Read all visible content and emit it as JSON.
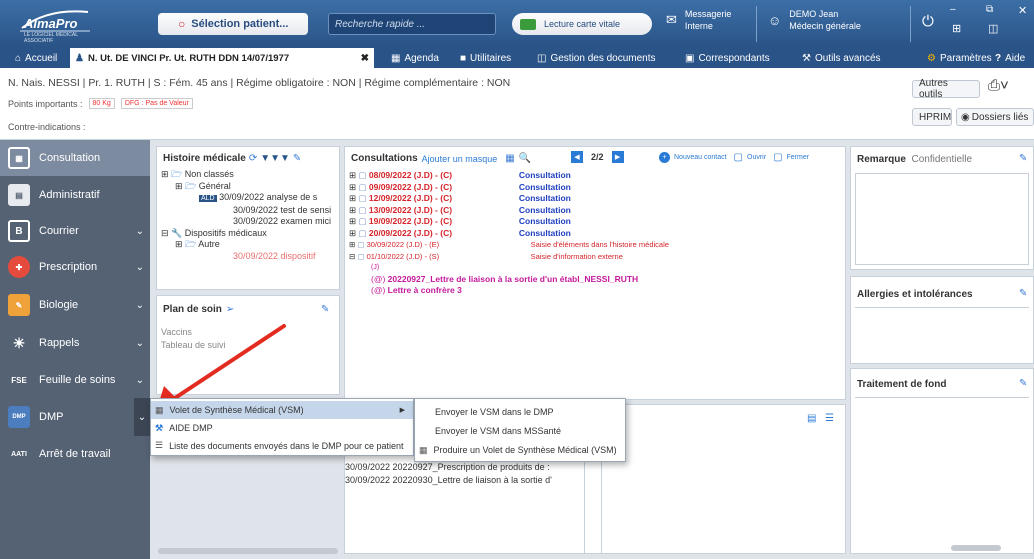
{
  "app": {
    "logo_text": "AlmaPro",
    "logo_tag": "LE LOGICIEL MEDICAL ASSOCIATIF"
  },
  "topbar": {
    "patient_select": "Sélection patient...",
    "quick_search_placeholder": "Recherche rapide ...",
    "vitale_label": "Lecture carte vitale",
    "messagerie_line1": "Messagerie",
    "messagerie_line2": "Interne",
    "doctor_name": "DEMO Jean",
    "doctor_role": "Médecin générale"
  },
  "tabs": {
    "home": "Accueil",
    "patient": "N. Ut. DE VINCI Pr. Ut. RUTH DDN 14/07/1977",
    "close": "✖",
    "agenda": "Agenda",
    "utilitaires": "Utilitaires",
    "gestion_docs": "Gestion des documents",
    "correspondants": "Correspondants",
    "outils_avances": "Outils avancés",
    "parametres": "Paramètres",
    "aide": "Aide"
  },
  "infobar": {
    "patient_line": "N. Nais. NESSI | Pr. 1. RUTH | S : Fém. 45 ans | Régime obligatoire : NON | Régime complémentaire : NON",
    "points_label": "Points importants :",
    "weight_badge": "80 Kg",
    "dfg_badge": "DFG : Pas de Valeur",
    "contre_label": "Contre-indications :",
    "autres_outils": "Autres outils",
    "hprim": "HPRIM",
    "dossiers_lies": "Dossiers liés"
  },
  "sidebar": {
    "items": [
      {
        "label": "Consultation",
        "icon": "consultation-icon"
      },
      {
        "label": "Administratif",
        "icon": "admin-icon"
      },
      {
        "label": "Courrier",
        "icon": "courrier-icon"
      },
      {
        "label": "Prescription",
        "icon": "prescription-icon"
      },
      {
        "label": "Biologie",
        "icon": "biologie-icon"
      },
      {
        "label": "Rappels",
        "icon": "rappels-icon"
      },
      {
        "label": "Feuille de soins",
        "icon_text": "FSE"
      },
      {
        "label": "DMP",
        "icon_text": "DMP"
      },
      {
        "label": "Arrêt de travail",
        "icon_text": "AATI"
      }
    ]
  },
  "histoire": {
    "title": "Histoire médicale",
    "rows": [
      "Non classés",
      "Général",
      "ALD",
      "30/09/2022 analyse de s",
      "30/09/2022 test de sensi",
      "30/09/2022 examen mici",
      "Dispositifs médicaux",
      "Autre",
      "30/09/2022 dispositif"
    ]
  },
  "plan_soin": {
    "title": "Plan de soin",
    "rows": [
      "Vaccins",
      "Tableau de suivi"
    ]
  },
  "consultations": {
    "title": "Consultations",
    "add_mask": "Ajouter un masque",
    "page": "2/2",
    "new_contact": "Nouveau contact",
    "open": "Ouvrir",
    "close": "Fermer",
    "rows": [
      {
        "date": "08/09/2022 (J.D) - (C)",
        "label": "Consultation"
      },
      {
        "date": "09/09/2022 (J.D) - (C)",
        "label": "Consultation"
      },
      {
        "date": "12/09/2022 (J.D) - (C)",
        "label": "Consultation"
      },
      {
        "date": "13/09/2022 (J.D) - (C)",
        "label": "Consultation"
      },
      {
        "date": "19/09/2022 (J.D) - (C)",
        "label": "Consultation"
      },
      {
        "date": "20/09/2022 (J.D) - (C)",
        "label": "Consultation"
      },
      {
        "date": "30/09/2022 (J.D) - (E)",
        "label": "Saisie d'éléments dans l'histoire médicale"
      },
      {
        "date": "01/10/2022 (J.D) - (S)",
        "label": "Saisie d'information externe"
      }
    ],
    "sub_rows": [
      "(J)",
      "20220927_Lettre de liaison à la sortie d'un établ_NESSI_RUTH",
      "Lettre à confrère 3"
    ]
  },
  "documents": {
    "header_fragment": "ogie",
    "rows": [
      "30/09/2022 20220927_Prescription de produits de :",
      "30/09/2022 20220930_Lettre de liaison à la sortie d'"
    ]
  },
  "right_panels": {
    "remarque": "Remarque",
    "confidentielle": "Confidentielle",
    "allergies": "Allergies et intolérances",
    "traitement": "Traitement de fond"
  },
  "dmp_menu": {
    "items": [
      "Volet de Synthèse Médical (VSM)",
      "AIDE DMP",
      "Liste des documents envoyés dans le DMP pour ce patient"
    ],
    "submenu": [
      "Envoyer le VSM dans le DMP",
      "Envoyer le VSM dans MSSanté",
      "Produire un Volet de Synthèse Médical (VSM)"
    ]
  },
  "colors": {
    "top": "#2a5387",
    "sidebar": "#556274",
    "arrow": "#e32b20",
    "date_red": "#d5242a",
    "link_blue": "#1f3fbf"
  }
}
